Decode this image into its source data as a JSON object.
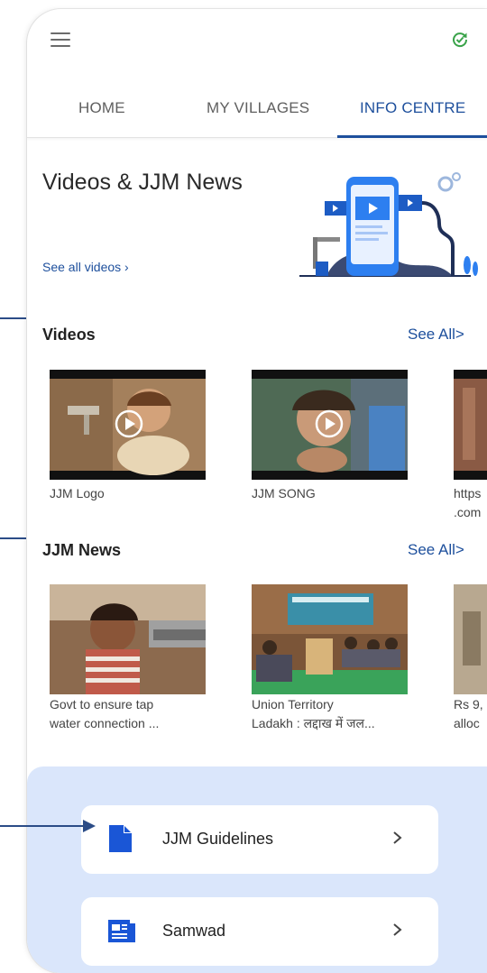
{
  "header": {
    "menu_icon": "hamburger-menu-icon",
    "sync_icon": "sync-check-icon",
    "sync_color": "#3aa34a"
  },
  "tabs": [
    {
      "label": "HOME",
      "active": false
    },
    {
      "label": "MY VILLAGES",
      "active": false
    },
    {
      "label": "INFO CENTRE",
      "active": true
    }
  ],
  "hero": {
    "title": "Videos & JJM News",
    "link": "See all videos  ›"
  },
  "videos": {
    "title": "Videos",
    "see_all": "See All>",
    "items": [
      {
        "caption": "JJM Logo"
      },
      {
        "caption": "JJM SONG"
      },
      {
        "caption": "https",
        "caption2": ".com"
      }
    ]
  },
  "news": {
    "title": "JJM News",
    "see_all": "See All>",
    "items": [
      {
        "line1": "Govt to ensure tap",
        "line2": "water connection ..."
      },
      {
        "line1": "Union Territory",
        "line2": "Ladakh : लद्दाख में जल..."
      },
      {
        "line1": "Rs 9,",
        "line2": "alloc"
      }
    ]
  },
  "resources": [
    {
      "label": "JJM Guidelines",
      "icon": "document-icon"
    },
    {
      "label": "Samwad",
      "icon": "newspaper-icon"
    }
  ],
  "colors": {
    "accent": "#1d4f9c",
    "panel": "#dae6fb"
  }
}
